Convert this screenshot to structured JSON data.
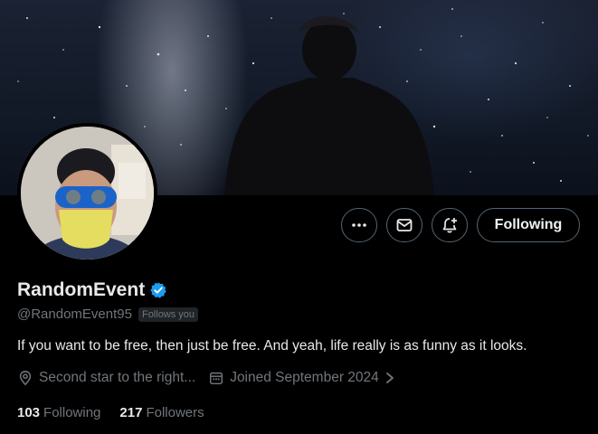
{
  "profile": {
    "display_name": "RandomEvent",
    "handle": "@RandomEvent95",
    "follows_you": "Follows you",
    "bio": "If you want to be free, then just be free. And yeah, life really is as funny as it looks.",
    "location": "Second star to the right...",
    "joined": "Joined September 2024"
  },
  "actions": {
    "more_icon": "more-icon",
    "message_icon": "envelope-icon",
    "notify_icon": "bell-plus-icon",
    "following_label": "Following"
  },
  "stats": {
    "following_count": "103",
    "following_label": "Following",
    "followers_count": "217",
    "followers_label": "Followers"
  },
  "colors": {
    "background": "#000000",
    "text": "#e7e9ea",
    "muted": "#71767b",
    "verified": "#1d9bf0",
    "border": "#536471"
  }
}
